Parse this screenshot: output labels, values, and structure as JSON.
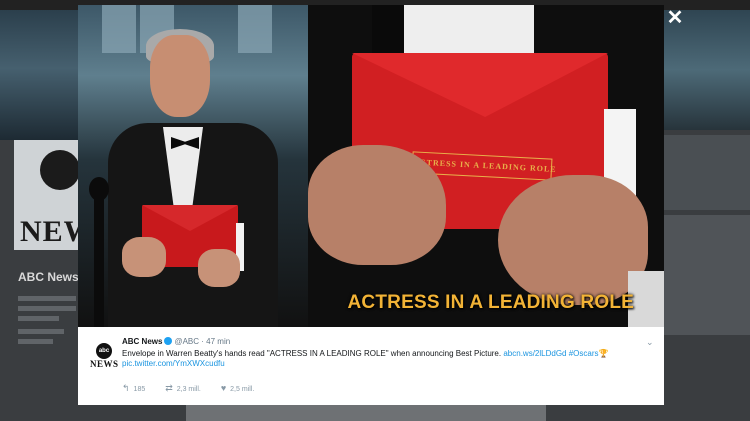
{
  "overlay": {
    "close_glyph": "✕"
  },
  "background": {
    "profile_avatar_text": "NEWS",
    "profile_name": "ABC News"
  },
  "media": {
    "envelope_label": "ACTRESS IN A LEADING ROLE",
    "caption": "ACTRESS IN A LEADING ROLE"
  },
  "tweet": {
    "avatar_top": "abc",
    "avatar_bottom": "NEWS",
    "name": "ABC News",
    "handle": "@ABC",
    "time": "· 47 min",
    "text": "Envelope in Warren Beatty's hands read \"ACTRESS IN A LEADING ROLE\" when announcing Best Picture.",
    "link1": "abcn.ws/2lLDdGd",
    "hashtag": "#Oscars",
    "trophy": "🏆",
    "pic_link": "pic.twitter.com/YmXWXcudfu",
    "reply_count": "185",
    "retweet_count": "2,3 mill.",
    "like_count": "2,5 mill.",
    "caret_glyph": "⌄"
  },
  "icons": {
    "reply": "↰",
    "retweet": "⇄",
    "like": "♥"
  }
}
